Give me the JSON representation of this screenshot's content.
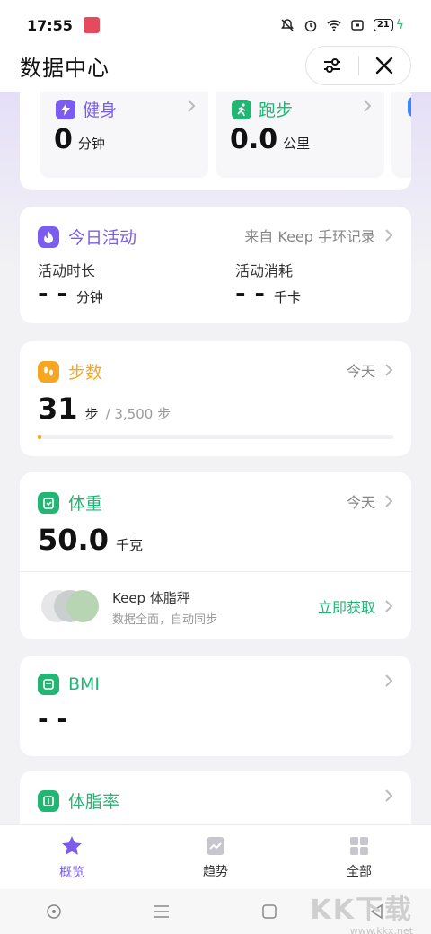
{
  "status": {
    "time": "17:55",
    "battery": "21"
  },
  "header": {
    "title": "数据中心"
  },
  "sport": {
    "items": [
      {
        "label": "健身",
        "value": "0",
        "unit": "分钟",
        "color": "#7b5cf0"
      },
      {
        "label": "跑步",
        "value": "0.0",
        "unit": "公里",
        "color": "#22b573"
      }
    ]
  },
  "activity": {
    "title": "今日活动",
    "source": "来自 Keep 手环记录",
    "duration_label": "活动时长",
    "duration_value": "- -",
    "duration_unit": "分钟",
    "consume_label": "活动消耗",
    "consume_value": "- -",
    "consume_unit": "千卡"
  },
  "steps": {
    "title": "步数",
    "period": "今天",
    "value": "31",
    "unit": "步",
    "goal": "/ 3,500 步",
    "progress": 0.009
  },
  "weight": {
    "title": "体重",
    "period": "今天",
    "value": "50.0",
    "unit": "千克",
    "promo_title": "Keep 体脂秤",
    "promo_sub": "数据全面，自动同步",
    "promo_action": "立即获取"
  },
  "bmi": {
    "title": "BMI",
    "value": "- -"
  },
  "bodyfat": {
    "title": "体脂率"
  },
  "nav": {
    "overview": "概览",
    "trend": "趋势",
    "all": "全部"
  },
  "watermark": {
    "big": "KK下载",
    "small": "www.kkx.net"
  },
  "colors": {
    "accent": "#7b5cf0",
    "green": "#22b573",
    "orange": "#f5a623"
  }
}
